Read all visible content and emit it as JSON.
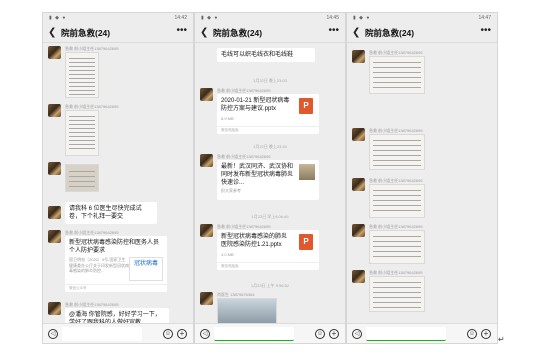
{
  "group_title": "院前急救(24)",
  "sender_label": "急救 前小姐主任13879642695",
  "sender_label_b": "肖医生 13879676364",
  "panels": [
    {
      "status_time": "14:42",
      "messages": {
        "text1": "请我科 6 位医生尽快完成试卷，下个礼拜一要交",
        "card1_title": "新型冠状病毒感染防控和医务人员个人防护要求",
        "card1_desc": "国卫明电（2020）9号-国家卫生健康委办公厅关于印发新型冠状病毒感染的肺炎防控...",
        "card1_thumb": "冠状病毒",
        "card1_foot": "微信公众号",
        "text2": "@潘海 你管院感，好好学习一下，学好了跟我科的人做好宣教"
      }
    },
    {
      "status_time": "14:45",
      "messages": {
        "text0": "毛线可以织毛线衣和毛线鞋",
        "ts1": "1月22日 晚上23:03",
        "file1_name": "2020-01-21 新型冠状病毒防控方案与建议.pptx",
        "file1_size": "8.9 MB",
        "file_foot": "微信电脑版",
        "ts2": "1月22日 晚上23:43",
        "link_title": "最新！武汉同济、武汉协和同时发布新型冠状病毒肺炎快速诊...",
        "link_src": "织大家参考",
        "ts3": "1月23日 早上8:06:46",
        "file2_name": "新型冠状病毒感染的肺炎医院感染防控1.21.pptx",
        "file2_size": "4.0 MB",
        "ts4": "1月23日 上午 9:56:52",
        "ppt_icon": "P"
      }
    },
    {
      "status_time": "14:47"
    }
  ],
  "icons": {
    "voice": "voice-icon",
    "emoji": "emoji-icon",
    "plus": "plus-icon",
    "back": "back-icon",
    "more": "more-icon"
  },
  "glyphs": {
    "back": "❮",
    "more": "•••",
    "voice": "◁",
    "emoji": "☺",
    "plus": "+",
    "return": "↵"
  }
}
